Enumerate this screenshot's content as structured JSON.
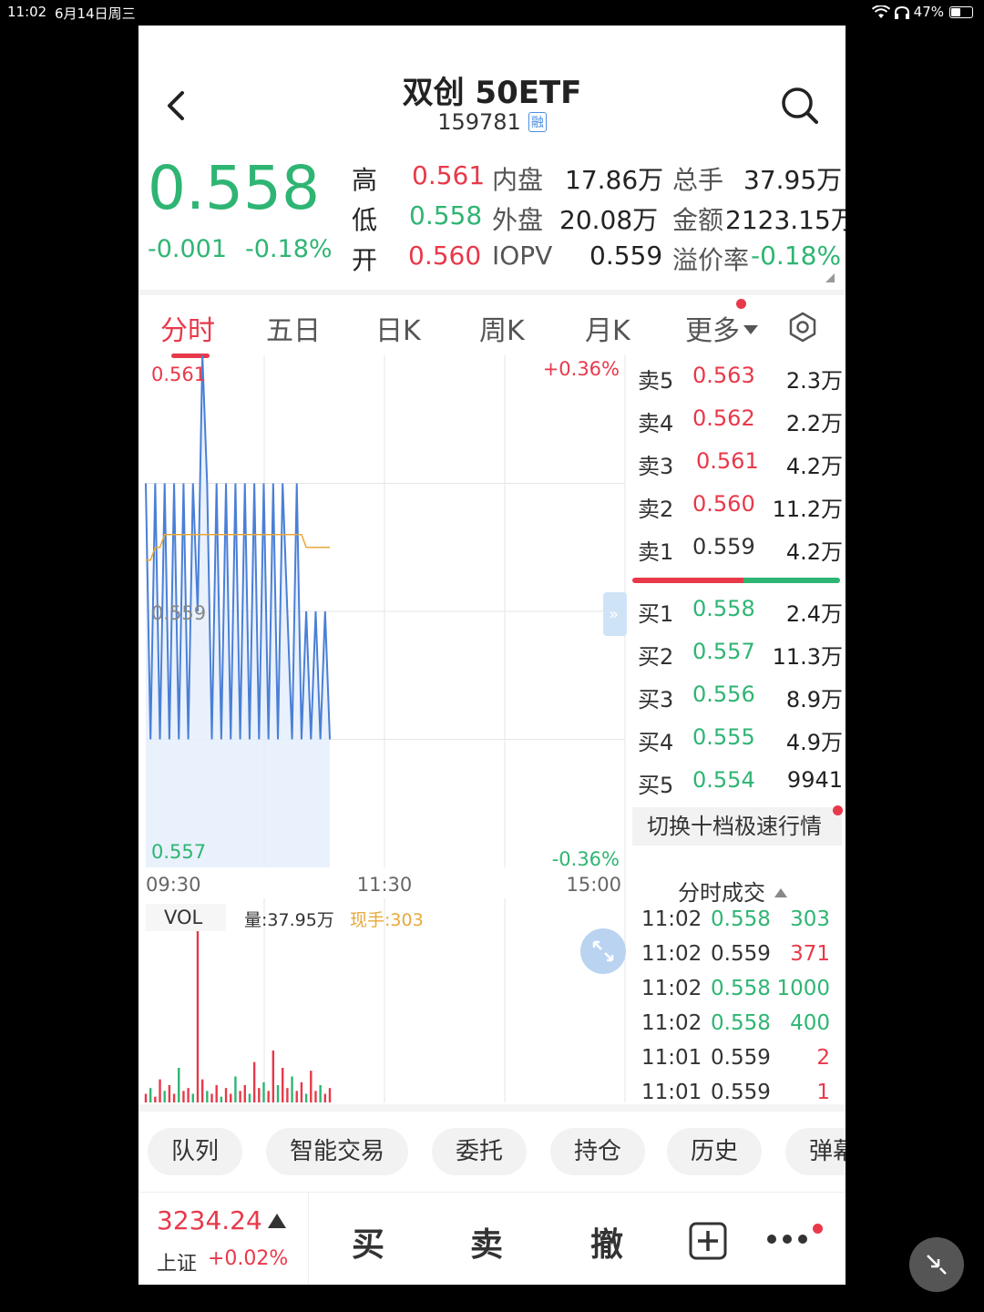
{
  "status": {
    "time": "11:02",
    "date": "6月14日周三",
    "battery": "47%"
  },
  "header": {
    "title": "双创 50ETF",
    "code": "159781",
    "badge": "融"
  },
  "price": {
    "last": "0.558",
    "change": "-0.001",
    "change_pct": "-0.18%"
  },
  "quote": [
    {
      "label": "高",
      "value": "0.561",
      "color": "red"
    },
    {
      "label": "低",
      "value": "0.558",
      "color": "green"
    },
    {
      "label": "开",
      "value": "0.560",
      "color": "red"
    },
    {
      "label": "内盘",
      "value": "17.86万"
    },
    {
      "label": "外盘",
      "value": "20.08万"
    },
    {
      "label": "IOPV",
      "value": "0.559"
    },
    {
      "label": "总手",
      "value": "37.95万"
    },
    {
      "label": "金额",
      "value": "2123.15万"
    },
    {
      "label": "溢价率",
      "value": "-0.18%",
      "color": "green"
    }
  ],
  "tabs": [
    "分时",
    "五日",
    "日K",
    "周K",
    "月K",
    "更多"
  ],
  "chart": {
    "price_hi": "0.561",
    "price_mid": "0.559",
    "price_lo": "0.557",
    "pct_hi": "+0.36%",
    "pct_lo": "-0.36%",
    "time_labels": [
      "09:30",
      "11:30",
      "15:00"
    ],
    "vol_label": "VOL",
    "vol_total": "量:37.95万",
    "vol_now": "现手:303"
  },
  "chart_data": {
    "type": "line",
    "title": "",
    "ylim": [
      0.557,
      0.561
    ],
    "series": [
      {
        "name": "",
        "values": [
          0.56,
          0.558,
          0.56,
          0.558,
          0.56,
          0.558,
          0.56,
          0.558,
          0.56,
          0.558,
          0.56,
          0.559,
          0.561,
          0.56,
          0.558,
          0.56,
          0.558,
          0.56,
          0.558,
          0.56,
          0.558,
          0.56,
          0.558,
          0.56,
          0.558,
          0.56,
          0.558,
          0.56,
          0.558,
          0.56,
          0.559,
          0.558,
          0.56,
          0.558,
          0.559,
          0.558,
          0.559,
          0.558,
          0.559,
          0.558
        ]
      },
      {
        "name": "",
        "values": [
          0.5594,
          0.5594,
          0.5595,
          0.5595,
          0.5596,
          0.5596,
          0.5596,
          0.5596,
          0.5596,
          0.5596,
          0.5596,
          0.5596,
          0.5596,
          0.5596,
          0.5596,
          0.5596,
          0.5596,
          0.5596,
          0.5596,
          0.5596,
          0.5596,
          0.5596,
          0.5596,
          0.5596,
          0.5596,
          0.5596,
          0.5596,
          0.5596,
          0.5596,
          0.5596,
          0.5596,
          0.5596,
          0.5596,
          0.5596,
          0.5595,
          0.5595,
          0.5595,
          0.5595,
          0.5595,
          0.5595
        ]
      }
    ],
    "volume": [
      3,
      5,
      2,
      8,
      4,
      6,
      3,
      12,
      4,
      5,
      3,
      60,
      8,
      4,
      3,
      6,
      2,
      5,
      3,
      9,
      4,
      6,
      3,
      14,
      5,
      7,
      4,
      18,
      6,
      12,
      5,
      9,
      4,
      7,
      3,
      11,
      4,
      6,
      3,
      5
    ]
  },
  "orderbook": {
    "asks": [
      {
        "label": "卖5",
        "price": "0.563",
        "vol": "2.3万"
      },
      {
        "label": "卖4",
        "price": "0.562",
        "vol": "2.2万"
      },
      {
        "label": "卖3",
        "price": "0.561",
        "vol": "4.2万"
      },
      {
        "label": "卖2",
        "price": "0.560",
        "vol": "11.2万"
      },
      {
        "label": "卖1",
        "price": "0.559",
        "vol": "4.2万"
      }
    ],
    "bids": [
      {
        "label": "买1",
        "price": "0.558",
        "vol": "2.4万"
      },
      {
        "label": "买2",
        "price": "0.557",
        "vol": "11.3万"
      },
      {
        "label": "买3",
        "price": "0.556",
        "vol": "8.9万"
      },
      {
        "label": "买4",
        "price": "0.555",
        "vol": "4.9万"
      },
      {
        "label": "买5",
        "price": "0.554",
        "vol": "9941"
      }
    ],
    "switch_label": "切换十档极速行情",
    "trades_title": "分时成交",
    "trades": [
      {
        "t": "11:02",
        "p": "0.558",
        "v": "303",
        "pc": "green",
        "vc": "green"
      },
      {
        "t": "11:02",
        "p": "0.559",
        "v": "371",
        "pc": "gray",
        "vc": "red"
      },
      {
        "t": "11:02",
        "p": "0.558",
        "v": "1000",
        "pc": "green",
        "vc": "green"
      },
      {
        "t": "11:02",
        "p": "0.558",
        "v": "400",
        "pc": "green",
        "vc": "green"
      },
      {
        "t": "11:01",
        "p": "0.559",
        "v": "2",
        "pc": "gray",
        "vc": "red"
      },
      {
        "t": "11:01",
        "p": "0.559",
        "v": "1",
        "pc": "gray",
        "vc": "red"
      }
    ]
  },
  "pills": [
    "队列",
    "智能交易",
    "委托",
    "持仓",
    "历史",
    "弹幕"
  ],
  "bottom": {
    "index_value": "3234.24",
    "index_name": "上证",
    "index_change": "+0.02%",
    "buy": "买",
    "sell": "卖",
    "cancel": "撤"
  }
}
